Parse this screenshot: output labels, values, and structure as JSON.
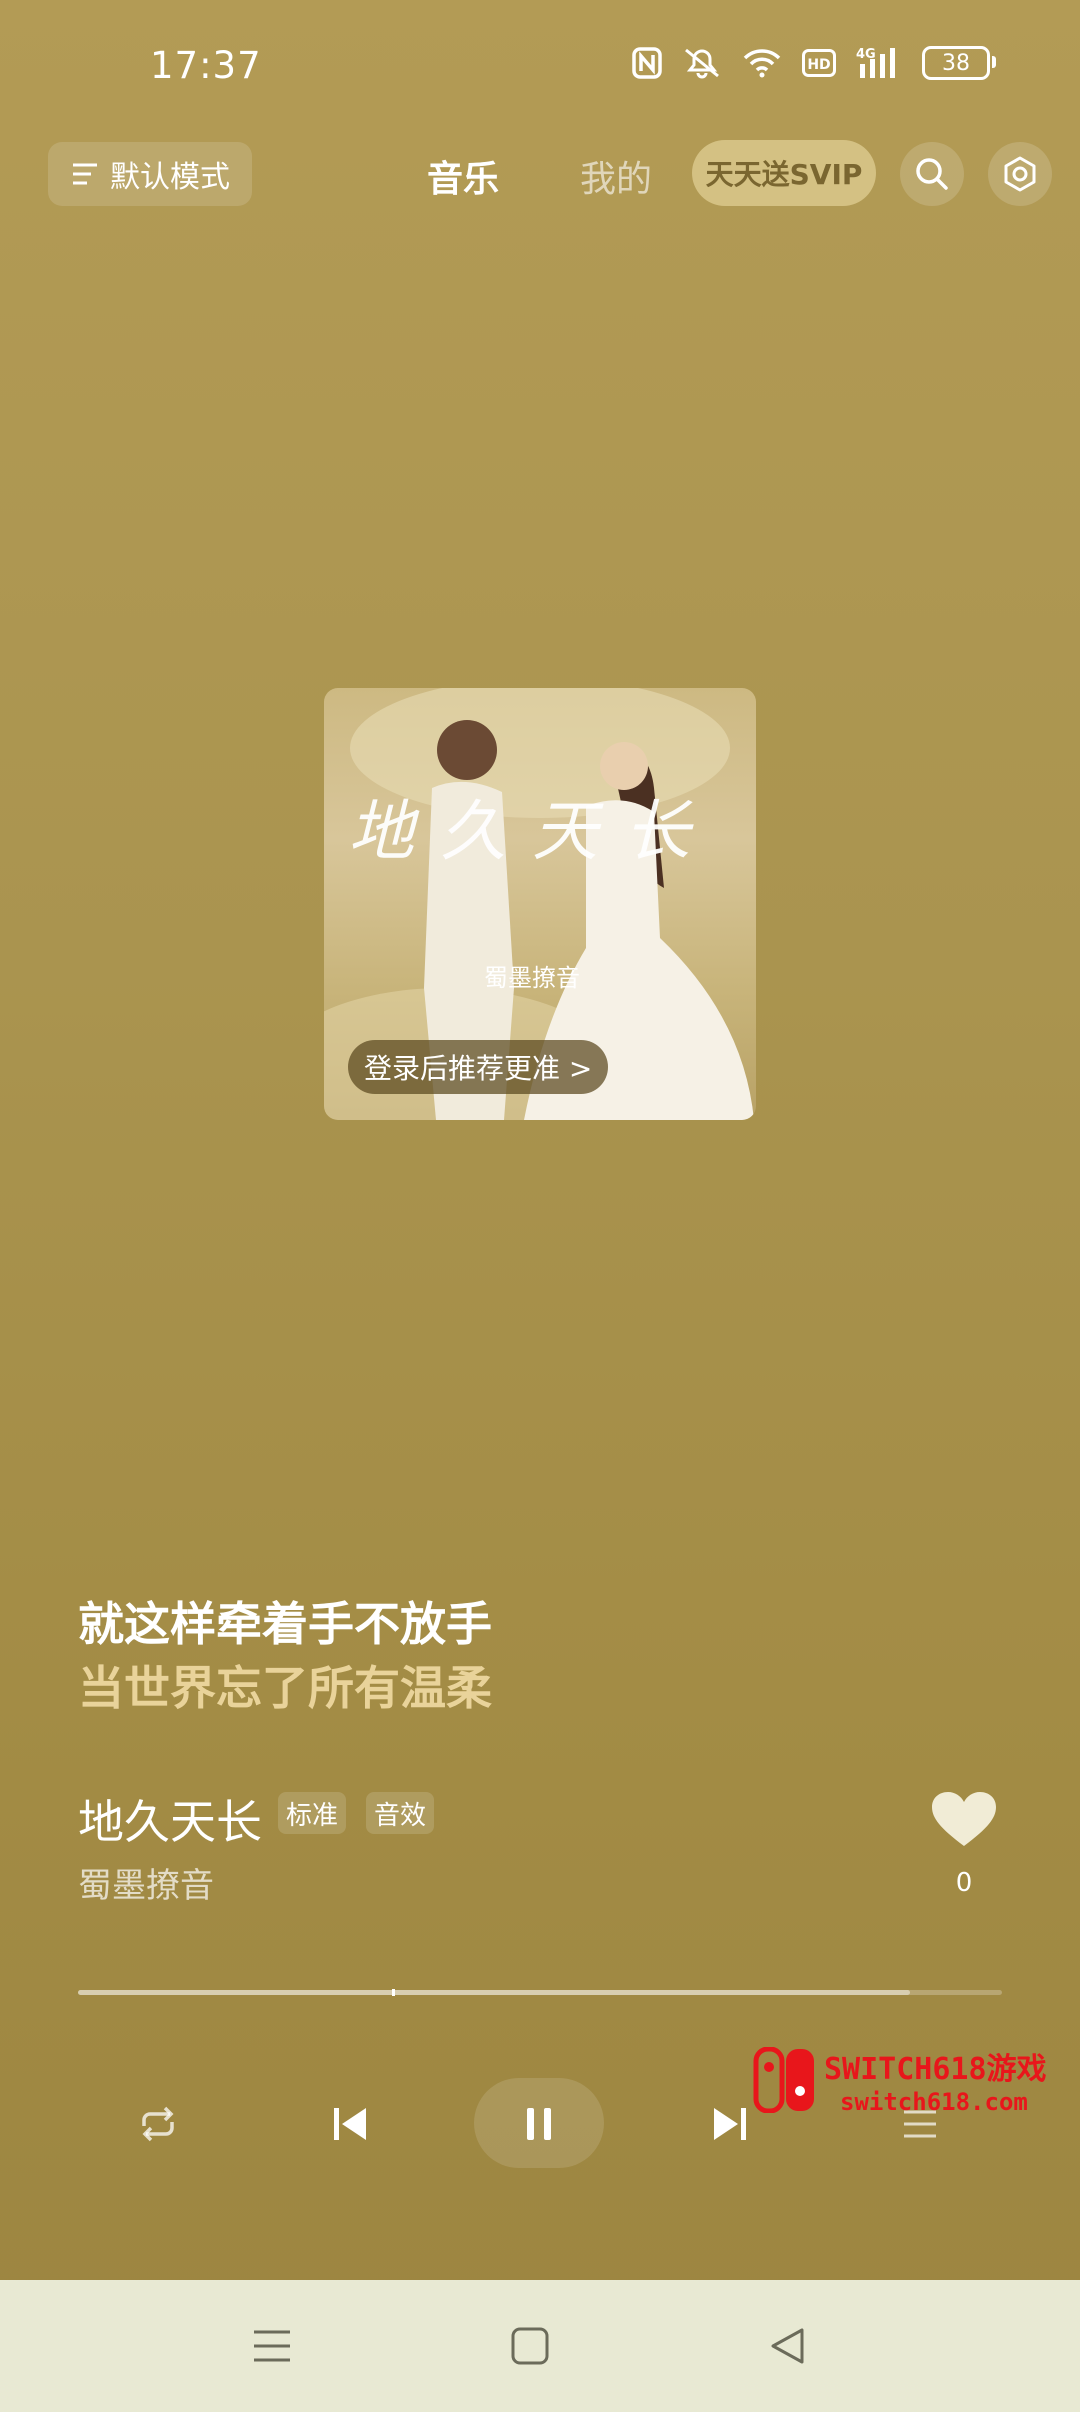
{
  "status_bar": {
    "time": "17:37",
    "battery": "38",
    "icons": [
      "nfc-icon",
      "mute-icon",
      "wifi-icon",
      "hd-icon",
      "signal-4g-icon",
      "battery-icon"
    ]
  },
  "top_bar": {
    "mode_label": "默认模式",
    "tabs": [
      {
        "label": "音乐",
        "active": true
      },
      {
        "label": "我的",
        "active": false
      }
    ],
    "svip_label": "天天送SVIP",
    "icons": [
      "search-icon",
      "settings-icon"
    ]
  },
  "cover": {
    "art_title": "地久天长",
    "art_artist": "蜀墨撩音",
    "login_prompt": "登录后推荐更准 >"
  },
  "lyrics": {
    "current": "就这样牵着手不放手",
    "next": "当世界忘了所有温柔"
  },
  "song": {
    "title": "地久天长",
    "tags": [
      "标准",
      "音效"
    ],
    "artist": "蜀墨撩音",
    "like_count": "0"
  },
  "progress": {
    "played_fraction": 0.34,
    "buffered_fraction": 0.9
  },
  "controls": [
    "repeat-icon",
    "previous-icon",
    "pause-icon",
    "next-icon",
    "playlist-icon"
  ],
  "watermark": {
    "line1": "SWITCH618游戏",
    "line2": "switch618.com"
  },
  "nav_bar": [
    "menu-icon",
    "home-icon",
    "back-icon"
  ],
  "colors": {
    "background": "#aa944f",
    "lyric_next": "#e9d39a",
    "nav_bar": "#e8e9d3",
    "watermark": "#e8161b"
  }
}
